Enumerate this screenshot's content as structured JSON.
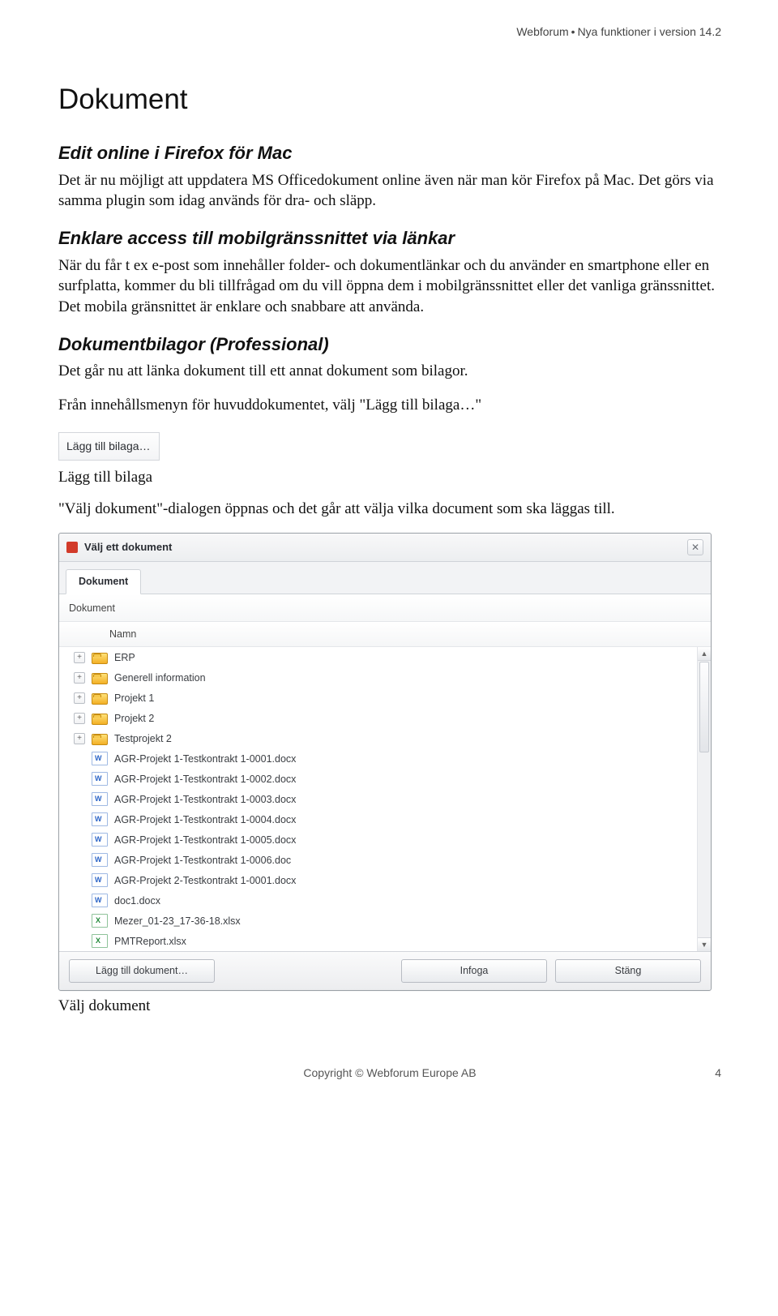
{
  "header": {
    "product": "Webforum",
    "tagline": "Nya funktioner i version 14.2"
  },
  "h1": "Dokument",
  "s1": {
    "title": "Edit online i Firefox för Mac",
    "p": "Det är nu möjligt att uppdatera MS Officedokument online även när man kör Firefox på Mac. Det görs via samma plugin som idag används för dra- och släpp."
  },
  "s2": {
    "title": "Enklare access till mobilgränssnittet via länkar",
    "p": "När du får t ex e-post som innehåller folder- och dokumentlänkar och du använder en smartphone eller en surfplatta, kommer du bli tillfrågad om du vill öppna dem i mobilgränssnittet eller det vanliga gränssnittet. Det mobila gränsnittet är enklare och snabbare att använda."
  },
  "s3": {
    "title": "Dokumentbilagor (Professional)",
    "p1": "Det går nu att länka dokument till ett annat dokument som bilagor.",
    "p2": "Från innehållsmenyn för huvuddokumentet, välj \"Lägg till bilaga…\""
  },
  "menuChip": "Lägg till bilaga…",
  "caption1": "Lägg till bilaga",
  "p_afterChip": "\"Välj dokument\"-dialogen öppnas och det går att välja vilka document som ska läggas till.",
  "dialog": {
    "title": "Välj ett dokument",
    "tab": "Dokument",
    "section": "Dokument",
    "column": "Namn",
    "rows": [
      {
        "type": "folder",
        "expand": true,
        "name": "ERP"
      },
      {
        "type": "folder",
        "expand": true,
        "name": "Generell information"
      },
      {
        "type": "folder",
        "expand": true,
        "name": "Projekt 1"
      },
      {
        "type": "folder",
        "expand": true,
        "name": "Projekt 2"
      },
      {
        "type": "folder",
        "expand": true,
        "name": "Testprojekt 2"
      },
      {
        "type": "doc",
        "expand": false,
        "name": "AGR-Projekt 1-Testkontrakt 1-0001.docx"
      },
      {
        "type": "doc",
        "expand": false,
        "name": "AGR-Projekt 1-Testkontrakt 1-0002.docx"
      },
      {
        "type": "doc",
        "expand": false,
        "name": "AGR-Projekt 1-Testkontrakt 1-0003.docx"
      },
      {
        "type": "doc",
        "expand": false,
        "name": "AGR-Projekt 1-Testkontrakt 1-0004.docx"
      },
      {
        "type": "doc",
        "expand": false,
        "name": "AGR-Projekt 1-Testkontrakt 1-0005.docx"
      },
      {
        "type": "doc",
        "expand": false,
        "name": "AGR-Projekt 1-Testkontrakt 1-0006.doc"
      },
      {
        "type": "doc",
        "expand": false,
        "name": "AGR-Projekt 2-Testkontrakt 1-0001.docx"
      },
      {
        "type": "doc",
        "expand": false,
        "name": "doc1.docx"
      },
      {
        "type": "xls",
        "expand": false,
        "name": "Mezer_01-23_17-36-18.xlsx"
      },
      {
        "type": "xls",
        "expand": false,
        "name": "PMTReport.xlsx"
      }
    ],
    "buttons": {
      "add": "Lägg till dokument…",
      "insert": "Infoga",
      "close": "Stäng"
    }
  },
  "caption2": "Välj dokument",
  "footer": {
    "copyright": "Copyright © Webforum Europe AB",
    "pageNo": "4"
  }
}
